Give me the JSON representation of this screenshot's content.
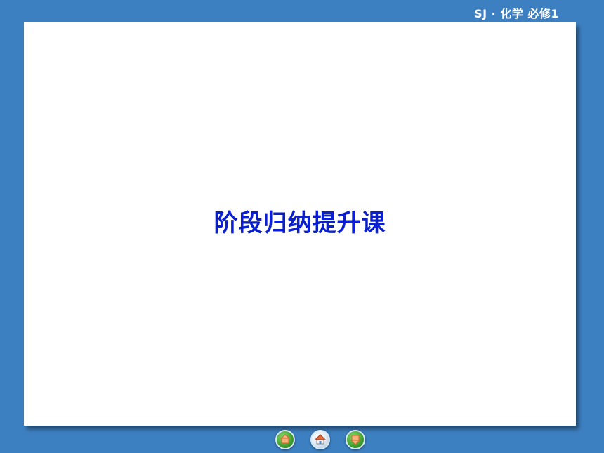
{
  "header": {
    "course_label": "SJ · 化学  必修1"
  },
  "slide": {
    "title": "阶段归纳提升课"
  },
  "nav": {
    "buttons": [
      {
        "icon": "previous-page-icon",
        "color": "#3f9e2c"
      },
      {
        "icon": "home-icon",
        "color": "#e06a3a"
      },
      {
        "icon": "next-page-icon",
        "color": "#3f9e2c"
      }
    ]
  },
  "colors": {
    "background": "#3d80c2",
    "slide": "#ffffff",
    "title": "#0a1fd0",
    "header_text": "#ffffff"
  }
}
